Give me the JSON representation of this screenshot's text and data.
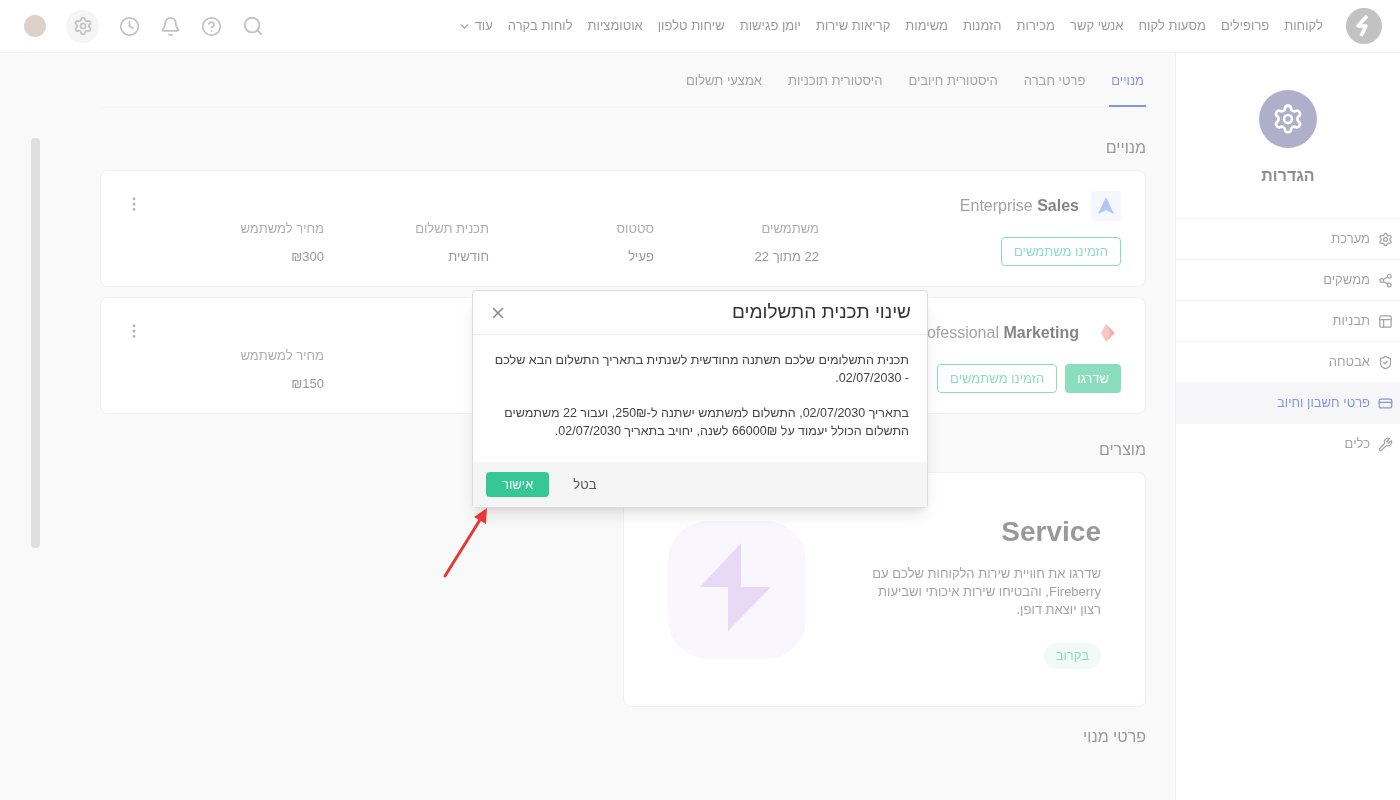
{
  "nav": {
    "items": [
      "לקוחות",
      "פרופילים",
      "מסעות לקוח",
      "אנשי קשר",
      "מכירות",
      "הזמנות",
      "משימות",
      "קריאות שירות",
      "יומן פגישות",
      "שיחות טלפון",
      "אוטומציות",
      "לוחות בקרה"
    ],
    "more": "עוד"
  },
  "settings_sidebar": {
    "title": "הגדרות",
    "items": [
      {
        "label": "מערכת",
        "selected": false
      },
      {
        "label": "ממשקים",
        "selected": false
      },
      {
        "label": "תבניות",
        "selected": false
      },
      {
        "label": "אבטחה",
        "selected": false
      },
      {
        "label": "פרטי חשבון וחיוב",
        "selected": true
      },
      {
        "label": "כלים",
        "selected": false
      }
    ]
  },
  "tabs": [
    {
      "label": "מנויים",
      "selected": true
    },
    {
      "label": "פרטי חברה",
      "selected": false
    },
    {
      "label": "היסטורית חיובים",
      "selected": false
    },
    {
      "label": "היסטורית תוכניות",
      "selected": false
    },
    {
      "label": "אמצעי תשלום",
      "selected": false
    }
  ],
  "subscriptions": {
    "heading": "מנויים",
    "plans": [
      {
        "name_light": "Enterprise",
        "name_bold": "Sales",
        "fields": [
          {
            "label": "משתמשים",
            "value": "22 מתוך 22"
          },
          {
            "label": "סטטוס",
            "value": "פעיל"
          },
          {
            "label": "תכנית תשלום",
            "value": "חודשית"
          },
          {
            "label": "מחיר למשתמש",
            "value": "₪300"
          }
        ],
        "buttons": [
          {
            "label": "הזמינו משתמשים",
            "kind": "outline"
          }
        ]
      },
      {
        "name_light": "ofessional",
        "name_bold": "Marketing",
        "fields": [
          {
            "label": "מחיר למשתמש",
            "value": "₪150"
          }
        ],
        "buttons": [
          {
            "label": "שדרגו",
            "kind": "filled"
          },
          {
            "label": "הזמינו משתמשים",
            "kind": "outline"
          }
        ]
      }
    ]
  },
  "products": {
    "heading": "מוצרים",
    "items": [
      {
        "title": "Service",
        "description": "שדרגו את חוויית שירות הלקוחות שלכם עם Fireberry, והבטיחו שירות איכותי ושביעות רצון יוצאת דופן.",
        "button": "בקרוב"
      }
    ]
  },
  "subscription_details": {
    "heading": "פרטי מנוי"
  },
  "modal": {
    "title": "שינוי תכנית התשלומים",
    "paragraphs": [
      "תכנית התשלומים שלכם תשתנה מחודשית לשנתית בתאריך התשלום הבא שלכם - 02/07/2030.",
      "בתאריך 02/07/2030, התשלום למשתמש ישתנה ל-250₪, ועבור 22 משתמשים התשלום הכולל יעמוד על 66000₪ לשנה, יחויב בתאריך 02/07/2030."
    ],
    "cancel": "בטל",
    "confirm": "אישור"
  }
}
